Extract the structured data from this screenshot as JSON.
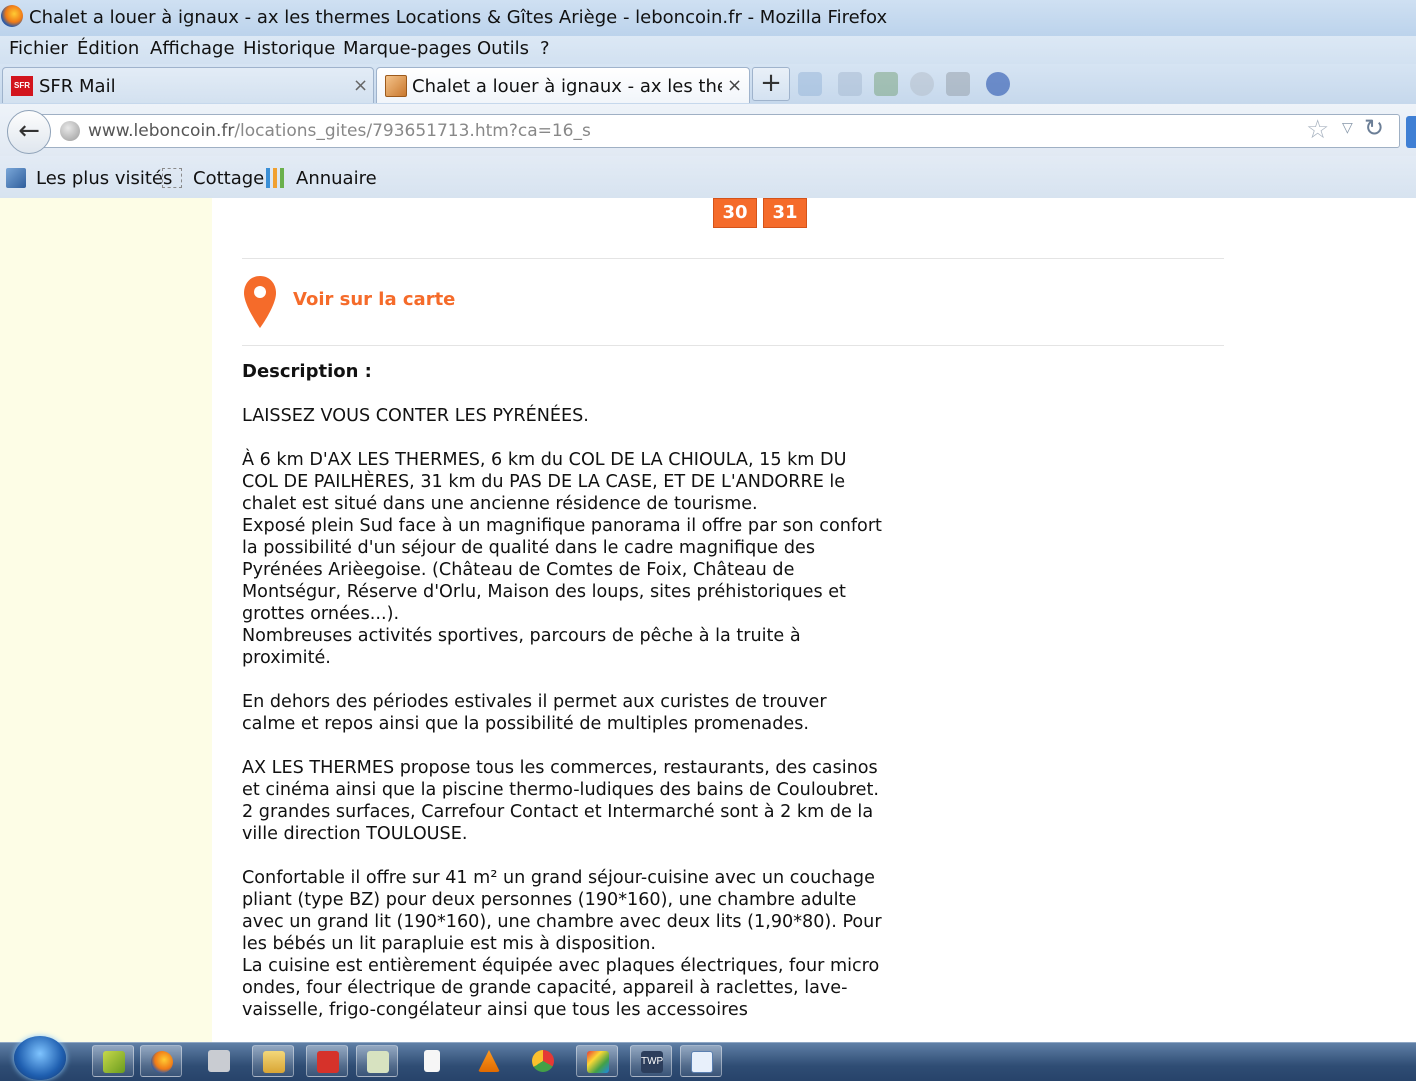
{
  "window": {
    "title": "Chalet a louer à ignaux - ax les thermes Locations & Gîtes Ariège - leboncoin.fr - Mozilla Firefox"
  },
  "menu": {
    "items": [
      "Fichier",
      "Édition",
      "Affichage",
      "Historique",
      "Marque-pages",
      "Outils",
      "?"
    ]
  },
  "tabs": [
    {
      "label": "SFR Mail",
      "close": "×",
      "icon": "sfr-icon"
    },
    {
      "label": "Chalet a louer à ignaux - ax les therm...",
      "close": "×",
      "icon": "package-icon"
    }
  ],
  "new_tab_label": "+",
  "navigation": {
    "url_domain": "www.leboncoin.fr",
    "url_path": "/locations_gites/793651713.htm?ca=16_s"
  },
  "bookmarks": [
    {
      "label": "Les plus visités",
      "icon": "most-visited-icon"
    },
    {
      "label": "Cottage",
      "icon": "folder-dotted-icon"
    },
    {
      "label": "Annuaire",
      "icon": "directory-icon"
    }
  ],
  "calendar": {
    "days": [
      "30",
      "31"
    ],
    "accent_color": "#f56b2a"
  },
  "map_link": "Voir sur la carte",
  "description": {
    "title": "Description :",
    "body": "LAISSEZ VOUS CONTER LES PYRÉNÉES.\n\nÀ 6 km D'AX LES THERMES, 6 km du COL DE LA CHIOULA, 15 km DU COL DE PAILHÈRES, 31 km du PAS DE LA CASE, ET DE L'ANDORRE le chalet est situé dans une ancienne résidence de tourisme.\nExposé plein Sud face à un magnifique panorama il offre par son confort la possibilité d'un séjour de qualité dans le cadre magnifique des Pyrénées Arièegoise. (Château de Comtes de Foix, Château de Montségur, Réserve d'Orlu, Maison des loups, sites préhistoriques et grottes ornées...).\nNombreuses activités sportives, parcours de pêche à la truite à proximité.\n\nEn dehors des périodes estivales il permet aux curistes de trouver calme et repos ainsi que la possibilité de multiples promenades.\n\nAX LES THERMES propose tous les commerces, restaurants, des casinos et cinéma ainsi que la piscine thermo-ludiques des bains de Couloubret.\n2 grandes surfaces, Carrefour Contact et Intermarché sont à 2 km de la ville direction TOULOUSE.\n\nConfortable il offre sur 41 m² un grand séjour-cuisine avec un couchage pliant (type BZ) pour deux personnes (190*160), une chambre adulte avec un grand lit (190*160), une chambre avec deux lits (1,90*80). Pour les bébés un lit parapluie est mis à disposition.\nLa cuisine est entièrement équipée avec plaques électriques, four micro ondes, four électrique de grande capacité, appareil à raclettes, lave-vaisselle, frigo-congélateur ainsi que tous les accessoires"
  },
  "taskbar": {
    "apps": [
      "start-orb",
      "app-icon",
      "firefox-icon",
      "app-icon",
      "file-explorer-icon",
      "pdf-icon",
      "document-icon",
      "blank-document-icon",
      "vlc-icon",
      "app-icon",
      "app-icon",
      "twp-icon",
      "notepad-icon"
    ],
    "twp_label": "TWP"
  }
}
